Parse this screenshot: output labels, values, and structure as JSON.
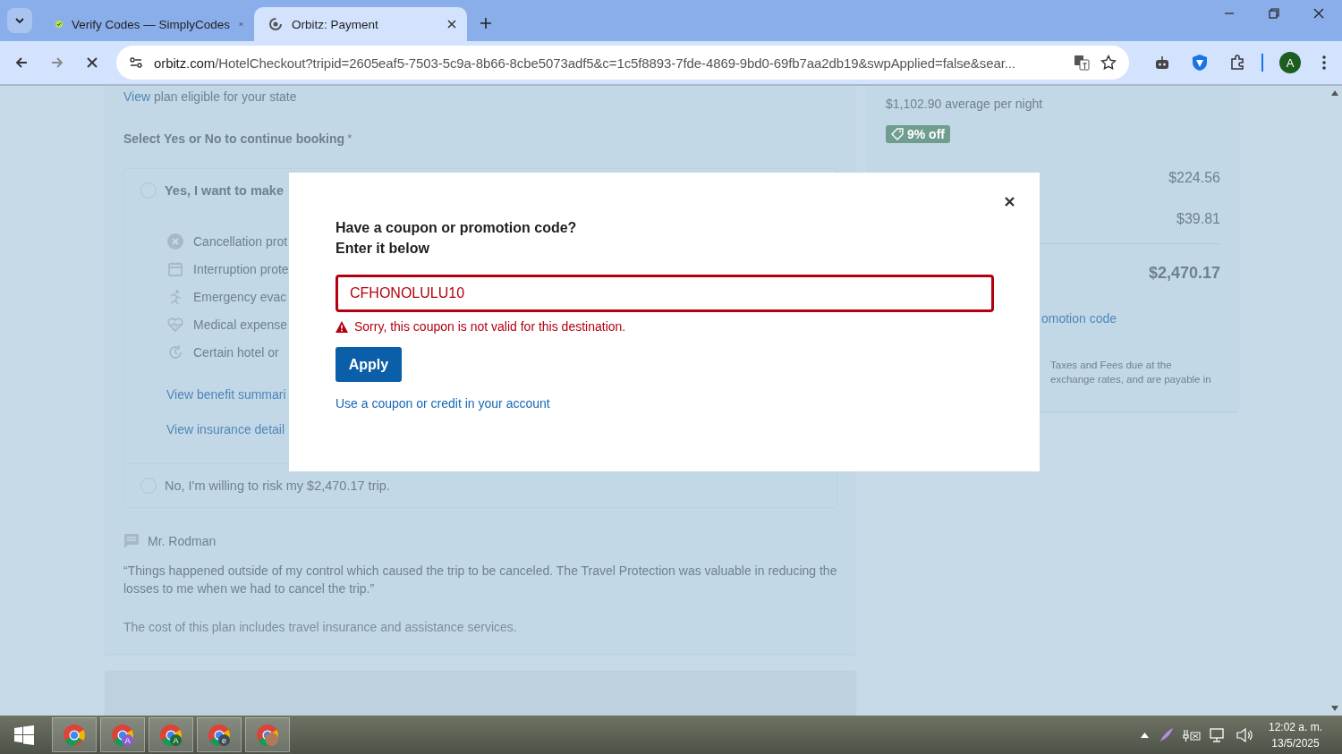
{
  "browser": {
    "tabs": [
      {
        "title": "Verify Codes — SimplyCodes",
        "selected": false,
        "kind": "check"
      },
      {
        "title": "Orbitz: Payment",
        "selected": true,
        "kind": "loading"
      }
    ],
    "url_host": "orbitz.com",
    "url_rest": "/HotelCheckout?tripid=2605eaf5-7503-5c9a-8b66-8cbe5073adf5&c=1c5f8893-7fde-4869-9bd0-69fb7aa2db19&swpApplied=false&sear...",
    "profile": "A"
  },
  "page": {
    "notice": {
      "link": "View",
      "text": " plan eligible for your state"
    },
    "question": "Select Yes or No to continue booking",
    "required_mark": "*",
    "options": [
      {
        "label": "Yes, I want to make",
        "selected": false,
        "benefits": [
          {
            "kind": "cancel",
            "label": "Cancellation prot"
          },
          {
            "kind": "calendar",
            "label": "Interruption prote"
          },
          {
            "kind": "runner",
            "label": "Emergency evac"
          },
          {
            "kind": "heart",
            "label": "Medical expense"
          },
          {
            "kind": "clock",
            "label": "Certain hotel or"
          }
        ],
        "links": [
          "View benefit summari",
          "View insurance detail"
        ]
      },
      {
        "label": "No, I'm willing to risk my $2,470.17 trip.",
        "selected": false
      }
    ],
    "review": {
      "author": "Mr. Rodman",
      "quote": "“Things happened outside of my control which caused the trip to be canceled. The Travel Protection was valuable in reducing the losses to me when we had to cancel the trip.”"
    },
    "footnote": "The cost of this plan includes travel insurance and assistance services."
  },
  "summary": {
    "average": "$1,102.90 average per night",
    "discount": "9% off",
    "amounts": [
      "$224.56",
      "$39.81"
    ],
    "total": "$2,470.17",
    "promo_link": "omotion code",
    "note_lines": [
      "Taxes and Fees due at the",
      "exchange rates, and are payable in"
    ]
  },
  "modal": {
    "heading": "Have a coupon or promotion code?",
    "subheading": "Enter it below",
    "code": "CFHONOLULU10",
    "invalid": true,
    "error": "Sorry, this coupon is not valid for this destination.",
    "button": "Apply",
    "link": "Use a coupon or credit in your account"
  },
  "taskbar": {
    "apps": [
      {
        "kind": "plain"
      },
      {
        "kind": "letter",
        "badge": "A",
        "color": "#8a5cd6"
      },
      {
        "kind": "letter",
        "badge": "A",
        "color": "#1f6b3a"
      },
      {
        "kind": "letter",
        "badge": "e",
        "color": "#3d4b57"
      },
      {
        "kind": "photo",
        "color": "#b07a5a"
      }
    ],
    "time": "12:02 a. m.",
    "date": "13/5/2025"
  }
}
